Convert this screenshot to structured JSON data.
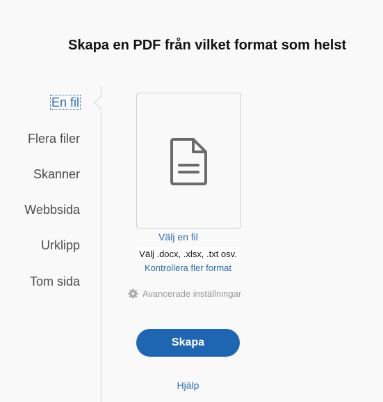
{
  "page": {
    "title": "Skapa en PDF från vilket format som helst"
  },
  "nav": {
    "items": [
      {
        "label": "En fil",
        "active": true
      },
      {
        "label": "Flera filer",
        "active": false
      },
      {
        "label": "Skanner",
        "active": false
      },
      {
        "label": "Webbsida",
        "active": false
      },
      {
        "label": "Urklipp",
        "active": false
      },
      {
        "label": "Tom sida",
        "active": false
      }
    ]
  },
  "main": {
    "dropzone_icon": "document-icon",
    "choose_file_label": "Välj en fil",
    "formats_hint": "Välj .docx, .xlsx, .txt osv.",
    "more_formats_label": "Kontrollera fler format",
    "advanced_settings_label": "Avancerade inställningar",
    "create_button_label": "Skapa",
    "help_label": "Hjälp"
  },
  "colors": {
    "accent": "#2d6dae",
    "primary_button": "#1f66b2",
    "background": "#f9f9f9"
  }
}
